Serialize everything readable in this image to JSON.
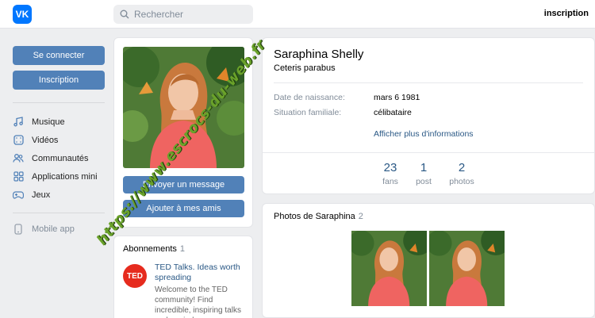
{
  "topbar": {
    "logo_text": "VK",
    "search_placeholder": "Rechercher",
    "signup_link": "inscription"
  },
  "sidebar": {
    "login_button": "Se connecter",
    "signup_button": "Inscription",
    "items": [
      {
        "label": "Musique",
        "icon": "music-icon"
      },
      {
        "label": "Vidéos",
        "icon": "video-icon"
      },
      {
        "label": "Communautés",
        "icon": "communities-icon"
      },
      {
        "label": "Applications mini",
        "icon": "apps-icon"
      },
      {
        "label": "Jeux",
        "icon": "gamepad-icon"
      }
    ],
    "mobile_app": "Mobile app"
  },
  "profile": {
    "name": "Saraphina Shelly",
    "status": "Ceteris parabus",
    "birth_label": "Date de naissance:",
    "birth_value": "mars 6 1981",
    "family_label": "Situation familiale:",
    "family_value": "célibataire",
    "more_info": "Afficher plus d'informations",
    "stats": [
      {
        "num": "23",
        "label": "fans"
      },
      {
        "num": "1",
        "label": "post"
      },
      {
        "num": "2",
        "label": "photos"
      }
    ]
  },
  "actions": {
    "message_button": "Envoyer un message",
    "add_friend_button": "Ajouter à mes amis"
  },
  "subscriptions": {
    "title": "Abonnements",
    "count": "1",
    "item_logo": "TED",
    "item_name": "TED Talks. Ideas worth spreading",
    "item_desc": "Welcome to the TED community! Find incredible, inspiring talks and a mind-"
  },
  "photos": {
    "title": "Photos de Saraphina",
    "count": "2"
  },
  "watermark": "https://www.escrocs-du-web.fr",
  "colors": {
    "accent": "#5181b8",
    "logo": "#0077ff",
    "link": "#2a5885",
    "ted": "#e62b1e",
    "watermark": "#6aa22a"
  }
}
